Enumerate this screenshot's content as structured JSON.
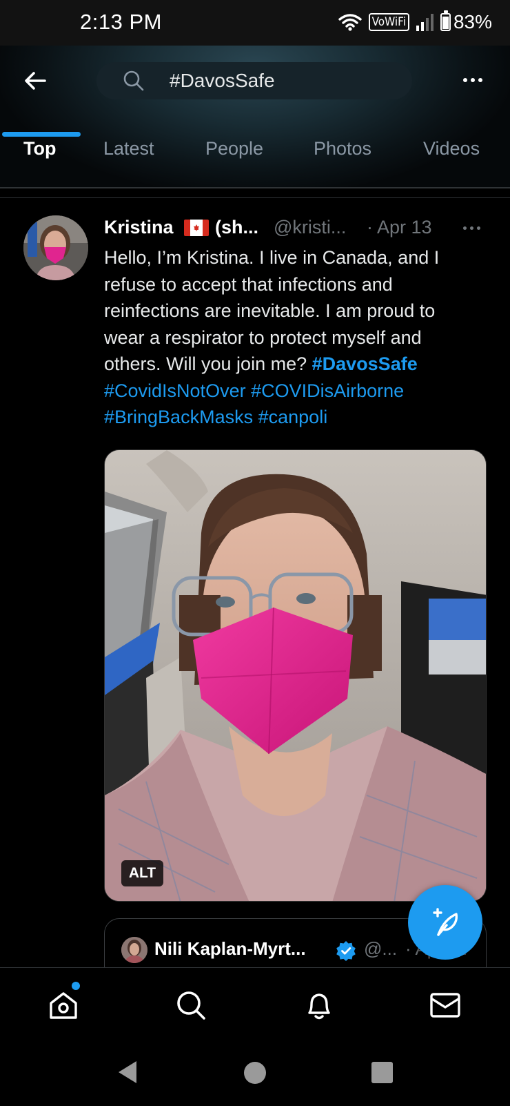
{
  "status_bar": {
    "time": "2:13 PM",
    "network_badge": "VoWiFi",
    "battery": "83%",
    "battery_level": 0.83,
    "icons": [
      "wifi-icon",
      "signal-icon",
      "battery-icon"
    ]
  },
  "search": {
    "query": "#DavosSafe"
  },
  "tabs": [
    {
      "label": "Top",
      "active": true
    },
    {
      "label": "Latest",
      "active": false
    },
    {
      "label": "People",
      "active": false
    },
    {
      "label": "Photos",
      "active": false
    },
    {
      "label": "Videos",
      "active": false
    }
  ],
  "tweet": {
    "display_name": "Kristina",
    "name_suffix": "(sh...",
    "handle": "@kristi...",
    "date": "· Apr 13",
    "text_lines": [
      "Hello, I’m Kristina. I live in Canada, and I",
      "refuse to accept that infections and",
      "reinfections are inevitable. I am proud to",
      "wear a respirator to protect myself and"
    ],
    "text_line5_plain": "others. Will you join me? ",
    "hashtags": {
      "davossafe": "#DavosSafe",
      "covidisnotover": "#CovidIsNotOver",
      "covidisairborne": "#COVIDisAirborne",
      "bringbackmasks": "#BringBackMasks",
      "canpoli": "#canpoli"
    },
    "media_alt_badge": "ALT"
  },
  "quoted_tweet": {
    "display_name": "Nili Kaplan-Myrt...",
    "handle": "@...",
    "date": "· Apr 11",
    "verified": true
  },
  "bottom_nav": [
    "home-icon",
    "search-icon",
    "notifications-icon",
    "messages-icon"
  ],
  "colors": {
    "accent": "#1d9bf0",
    "background": "#000000",
    "muted_text": "#71767b",
    "mask_pink": "#e0258f"
  }
}
